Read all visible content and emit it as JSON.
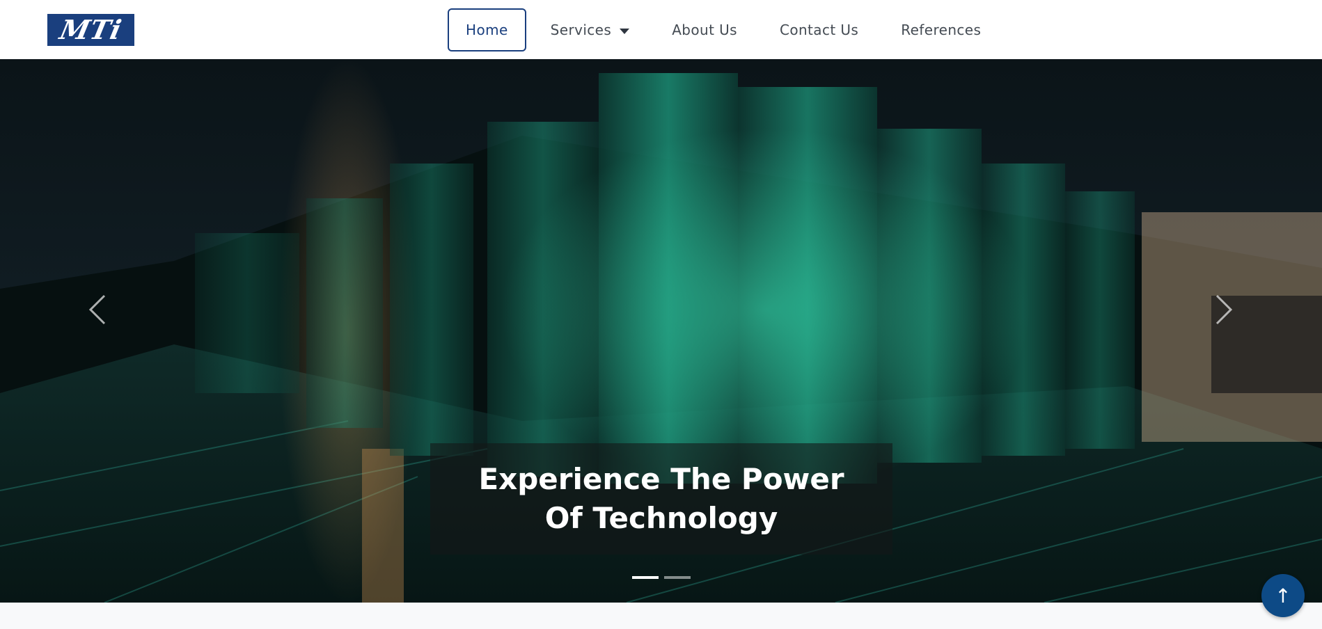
{
  "brand": {
    "logo_text": "MTi",
    "color": "#1a3f7e"
  },
  "nav": {
    "items": [
      {
        "label": "Home",
        "active": true
      },
      {
        "label": "Services",
        "has_dropdown": true
      },
      {
        "label": "About Us"
      },
      {
        "label": "Contact Us"
      },
      {
        "label": "References"
      }
    ]
  },
  "hero": {
    "caption": "Experience The Power Of Technology",
    "prev_icon": "chevron-left-icon",
    "next_icon": "chevron-right-icon",
    "slide_count": 2,
    "active_slide": 1
  },
  "back_to_top": {
    "symbol": "↑",
    "icon": "arrow-up-icon",
    "color": "#0d4a86"
  }
}
